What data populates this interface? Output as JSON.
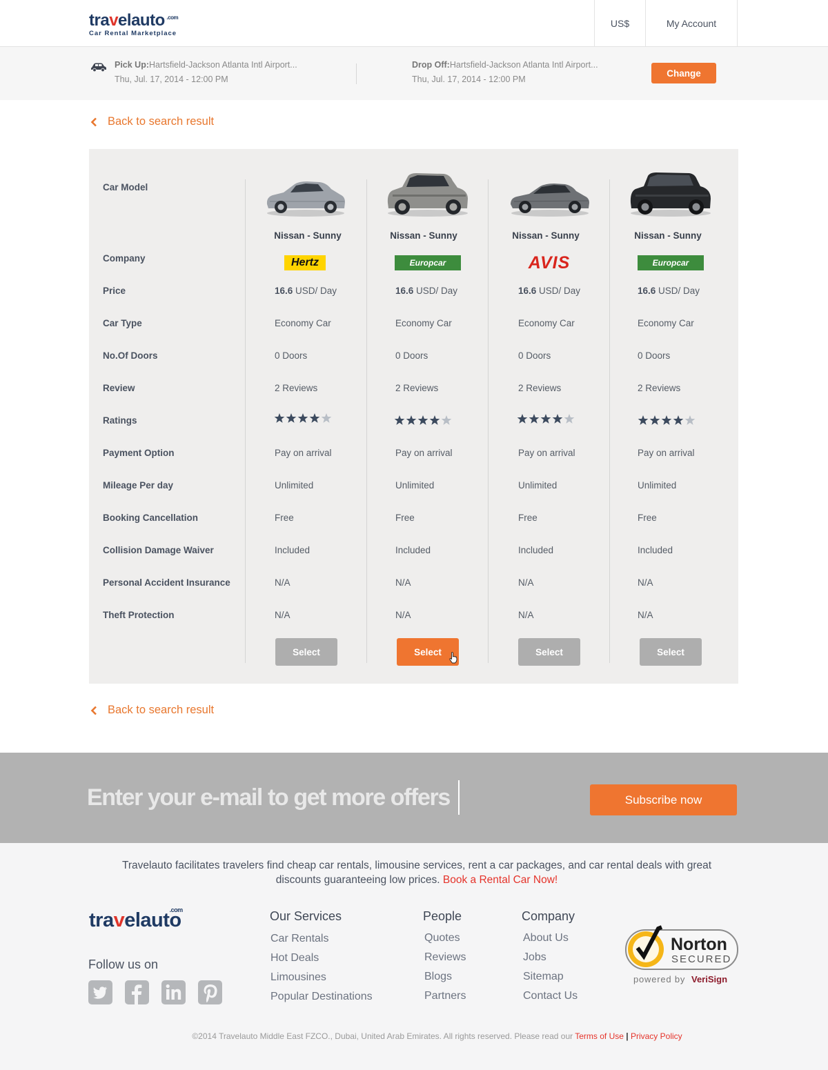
{
  "header": {
    "logo_main_a": "tra",
    "logo_main_b": "v",
    "logo_main_c": "elauto",
    "logo_com": ".com",
    "logo_tagline": "Car Rental Marketplace",
    "currency": "US$",
    "account": "My Account"
  },
  "summary": {
    "pickup_label": "Pick Up:",
    "pickup_location": "Hartsfield-Jackson Atlanta Intl Airport...",
    "pickup_datetime": "Thu, Jul. 17, 2014 - 12:00 PM",
    "dropoff_label": "Drop Off:",
    "dropoff_location": "Hartsfield-Jackson Atlanta Intl Airport...",
    "dropoff_datetime": "Thu, Jul. 17, 2014 - 12:00 PM",
    "change_button": "Change"
  },
  "back_link": "Back to search result",
  "comparison": {
    "row_labels": {
      "car_model": "Car Model",
      "company": "Company",
      "price": "Price",
      "car_type": "Car Type",
      "doors": "No.Of Doors",
      "review": "Review",
      "ratings": "Ratings",
      "payment": "Payment Option",
      "mileage": "Mileage Per day",
      "cancellation": "Booking Cancellation",
      "cdw": "Collision Damage Waiver",
      "pai": "Personal Accident Insurance",
      "theft": "Theft Protection"
    },
    "cars": [
      {
        "name": "Nissan - Sunny",
        "company": "Hertz",
        "price_value": "16.6",
        "price_unit": "USD/ Day",
        "car_type": "Economy Car",
        "doors": "0 Doors",
        "reviews": "2 Reviews",
        "rating": 4,
        "rating_max": 5,
        "payment": "Pay on arrival",
        "mileage": "Unlimited",
        "cancellation": "Free",
        "cdw": "Included",
        "pai": "N/A",
        "theft": "N/A",
        "select_label": "Select",
        "selected": false
      },
      {
        "name": "Nissan - Sunny",
        "company": "Europcar",
        "price_value": "16.6",
        "price_unit": "USD/ Day",
        "car_type": "Economy Car",
        "doors": "0 Doors",
        "reviews": "2 Reviews",
        "rating": 4,
        "rating_max": 5,
        "payment": "Pay on arrival",
        "mileage": "Unlimited",
        "cancellation": "Free",
        "cdw": "Included",
        "pai": "N/A",
        "theft": "N/A",
        "select_label": "Select",
        "selected": true
      },
      {
        "name": "Nissan - Sunny",
        "company": "AVIS",
        "price_value": "16.6",
        "price_unit": "USD/ Day",
        "car_type": "Economy Car",
        "doors": "0 Doors",
        "reviews": "2 Reviews",
        "rating": 4,
        "rating_max": 5,
        "payment": "Pay on arrival",
        "mileage": "Unlimited",
        "cancellation": "Free",
        "cdw": "Included",
        "pai": "N/A",
        "theft": "N/A",
        "select_label": "Select",
        "selected": false
      },
      {
        "name": "Nissan - Sunny",
        "company": "Europcar",
        "price_value": "16.6",
        "price_unit": "USD/ Day",
        "car_type": "Economy Car",
        "doors": "0 Doors",
        "reviews": "2 Reviews",
        "rating": 4,
        "rating_max": 5,
        "payment": "Pay on arrival",
        "mileage": "Unlimited",
        "cancellation": "Free",
        "cdw": "Included",
        "pai": "N/A",
        "theft": "N/A",
        "select_label": "Select",
        "selected": false
      }
    ]
  },
  "newsletter": {
    "placeholder": "Enter your e-mail to get more offers",
    "button": "Subscribe now"
  },
  "footer": {
    "about_text": "Travelauto facilitates travelers find cheap car rentals, limousine services, rent a car packages, and car rental deals with great discounts guaranteeing low prices.",
    "about_link": "Book a Rental Car Now!",
    "follow_us": "Follow us on",
    "services_title": "Our Services",
    "services": [
      "Car Rentals",
      "Hot Deals",
      "Limousines",
      "Popular Destinations"
    ],
    "people_title": "People",
    "people": [
      "Quotes",
      "Reviews",
      "Blogs",
      "Partners"
    ],
    "company_title": "Company",
    "company": [
      "About Us",
      "Jobs",
      "Sitemap",
      "Contact Us"
    ],
    "norton_main": "Norton",
    "norton_secured": "SECURED",
    "norton_powered": "powered by",
    "norton_verisign": "VeriSign",
    "copyright": "©2014 Travelauto Middle East FZCO., Dubai, United Arab Emirates. All rights reserved. Please read our",
    "terms": "Terms of Use",
    "separator": "|",
    "privacy": "Privacy Policy"
  },
  "colors": {
    "accent": "#ef7530",
    "brand_navy": "#1f3a63",
    "brand_red": "#e0352b",
    "panel_bg": "#efeeed",
    "star_filled": "#3c4a5e",
    "star_empty": "#b8bec6"
  }
}
